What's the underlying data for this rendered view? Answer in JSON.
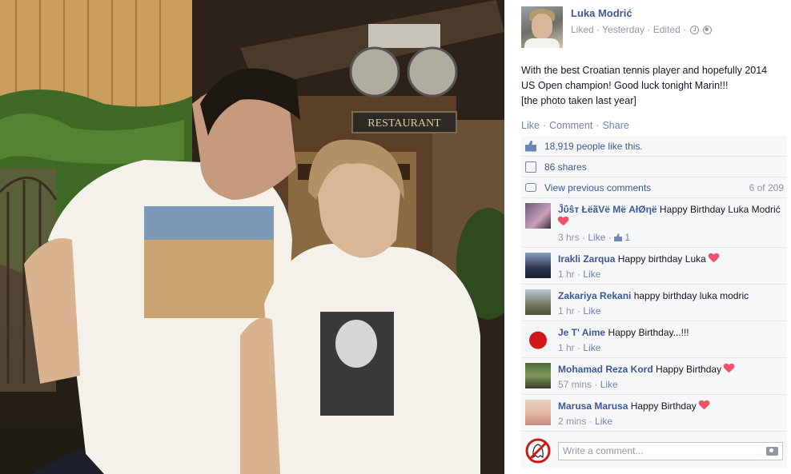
{
  "post": {
    "author": "Luka Modrić",
    "meta": "Liked · Yesterday · Edited ·",
    "text_lines": [
      "With the best Croatian tennis player and hopefully 2014",
      "US Open champion! Good luck tonight Marin!!!",
      "[the photo taken last year]"
    ],
    "photo_sign_text": "RESTAURANT"
  },
  "actions": {
    "like": "Like",
    "comment": "Comment",
    "share": "Share",
    "sep": "·"
  },
  "ufi": {
    "likes": "18,919 people like this.",
    "shares": "86 shares",
    "view_previous": "View previous comments",
    "count": "6 of 209"
  },
  "comments": [
    {
      "name": "Ĵΰŝт ŁёãVё Μё ΑłØηё",
      "text": "Happy Birthday Luka Modrić",
      "heart": true,
      "time": "3 hrs",
      "like": "Like",
      "likes": "1"
    },
    {
      "name": "Irakli Zarqua",
      "text": "Happy birthday Luka",
      "heart": true,
      "time": "1 hr",
      "like": "Like"
    },
    {
      "name": "Zakariya Rekani",
      "text": "happy birthday luka modric",
      "heart": false,
      "time": "1 hr",
      "like": "Like"
    },
    {
      "name": "Je T' Aime",
      "text": "Happy Birthday...!!!",
      "heart": false,
      "time": "1 hr",
      "like": "Like"
    },
    {
      "name": "Mohamad Reza Kord",
      "text": "Happy Birthday",
      "heart": true,
      "time": "57 mins",
      "like": "Like"
    },
    {
      "name": "Marusa Marusa",
      "text": "Happy Birthday",
      "heart": true,
      "time": "2 mins",
      "like": "Like"
    }
  ],
  "composer": {
    "placeholder": "Write a comment..."
  },
  "colors": {
    "link": "#3b5998",
    "muted": "#9197a3",
    "heart": "#f25268",
    "ufi_bg": "#f6f7f8"
  },
  "icons": [
    "clock-icon",
    "globe-icon",
    "like-icon",
    "share-icon",
    "comment-icon",
    "camera-icon",
    "heart-icon"
  ]
}
